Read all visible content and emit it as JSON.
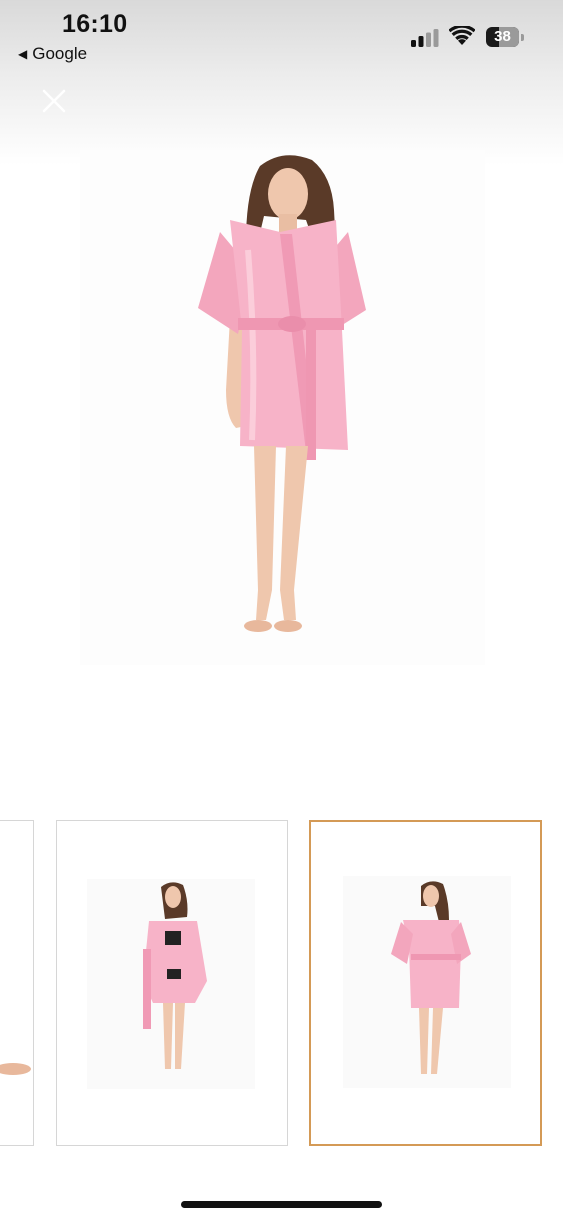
{
  "status_bar": {
    "time": "16:10",
    "back_label": "Google",
    "battery_level": "38",
    "battery_fraction": 0.38
  },
  "icons": {
    "close": "close-icon",
    "back": "back-arrow-icon",
    "signal": "cellular-signal-icon",
    "wifi": "wifi-icon",
    "battery": "battery-icon"
  },
  "colors": {
    "robe_pink": "#f6a9c1",
    "selected_border": "#d49a56",
    "thumb_border": "#d6d6d6"
  },
  "gallery": {
    "thumbnails_visible": 3,
    "selected_index": 2
  }
}
